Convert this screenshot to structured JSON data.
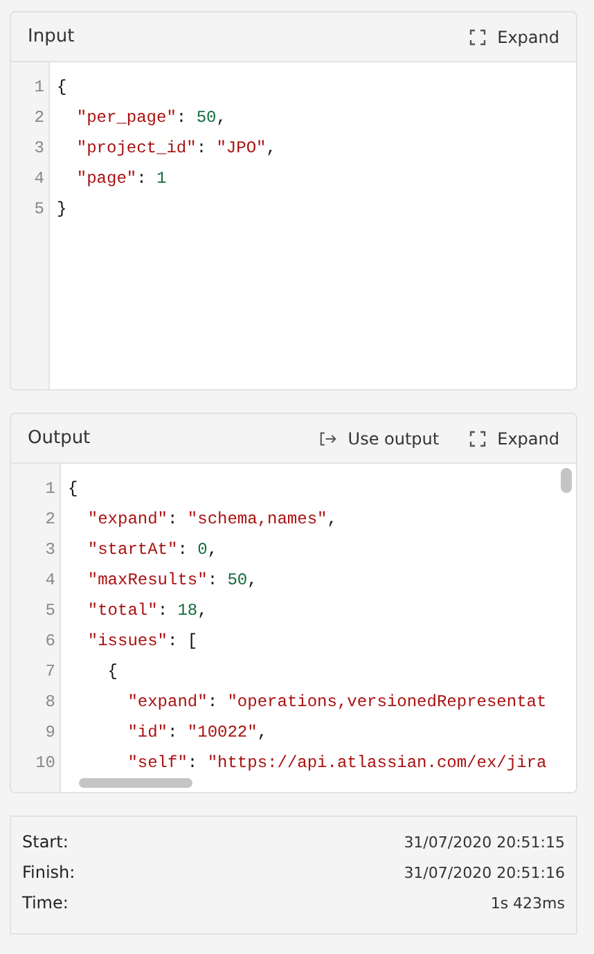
{
  "input": {
    "title": "Input",
    "expand_label": "Expand",
    "lines": [
      [
        {
          "kind": "punct",
          "text": "{"
        }
      ],
      [
        {
          "kind": "key",
          "text": "  \"per_page\""
        },
        {
          "kind": "punct",
          "text": ": "
        },
        {
          "kind": "number",
          "text": "50"
        },
        {
          "kind": "punct",
          "text": ","
        }
      ],
      [
        {
          "kind": "key",
          "text": "  \"project_id\""
        },
        {
          "kind": "punct",
          "text": ": "
        },
        {
          "kind": "string",
          "text": "\"JPO\""
        },
        {
          "kind": "punct",
          "text": ","
        }
      ],
      [
        {
          "kind": "key",
          "text": "  \"page\""
        },
        {
          "kind": "punct",
          "text": ": "
        },
        {
          "kind": "number",
          "text": "1"
        }
      ],
      [
        {
          "kind": "punct",
          "text": "}"
        }
      ]
    ],
    "line_numbers": [
      "1",
      "2",
      "3",
      "4",
      "5"
    ]
  },
  "output": {
    "title": "Output",
    "use_output_label": "Use output",
    "expand_label": "Expand",
    "lines": [
      [
        {
          "kind": "punct",
          "text": "{"
        }
      ],
      [
        {
          "kind": "key",
          "text": "  \"expand\""
        },
        {
          "kind": "punct",
          "text": ": "
        },
        {
          "kind": "string",
          "text": "\"schema,names\""
        },
        {
          "kind": "punct",
          "text": ","
        }
      ],
      [
        {
          "kind": "key",
          "text": "  \"startAt\""
        },
        {
          "kind": "punct",
          "text": ": "
        },
        {
          "kind": "number",
          "text": "0"
        },
        {
          "kind": "punct",
          "text": ","
        }
      ],
      [
        {
          "kind": "key",
          "text": "  \"maxResults\""
        },
        {
          "kind": "punct",
          "text": ": "
        },
        {
          "kind": "number",
          "text": "50"
        },
        {
          "kind": "punct",
          "text": ","
        }
      ],
      [
        {
          "kind": "key",
          "text": "  \"total\""
        },
        {
          "kind": "punct",
          "text": ": "
        },
        {
          "kind": "number",
          "text": "18"
        },
        {
          "kind": "punct",
          "text": ","
        }
      ],
      [
        {
          "kind": "key",
          "text": "  \"issues\""
        },
        {
          "kind": "punct",
          "text": ": ["
        }
      ],
      [
        {
          "kind": "punct",
          "text": "    {"
        }
      ],
      [
        {
          "kind": "key",
          "text": "      \"expand\""
        },
        {
          "kind": "punct",
          "text": ": "
        },
        {
          "kind": "string",
          "text": "\"operations,versionedRepresentat"
        }
      ],
      [
        {
          "kind": "key",
          "text": "      \"id\""
        },
        {
          "kind": "punct",
          "text": ": "
        },
        {
          "kind": "string",
          "text": "\"10022\""
        },
        {
          "kind": "punct",
          "text": ","
        }
      ],
      [
        {
          "kind": "key",
          "text": "      \"self\""
        },
        {
          "kind": "punct",
          "text": ": "
        },
        {
          "kind": "string",
          "text": "\"https://api.atlassian.com/ex/jira"
        }
      ]
    ],
    "line_numbers": [
      "1",
      "2",
      "3",
      "4",
      "5",
      "6",
      "7",
      "8",
      "9",
      "10"
    ]
  },
  "stats": [
    {
      "label": "Start:",
      "value": "31/07/2020 20:51:15"
    },
    {
      "label": "Finish:",
      "value": "31/07/2020 20:51:16"
    },
    {
      "label": "Time:",
      "value": "1s 423ms"
    }
  ]
}
